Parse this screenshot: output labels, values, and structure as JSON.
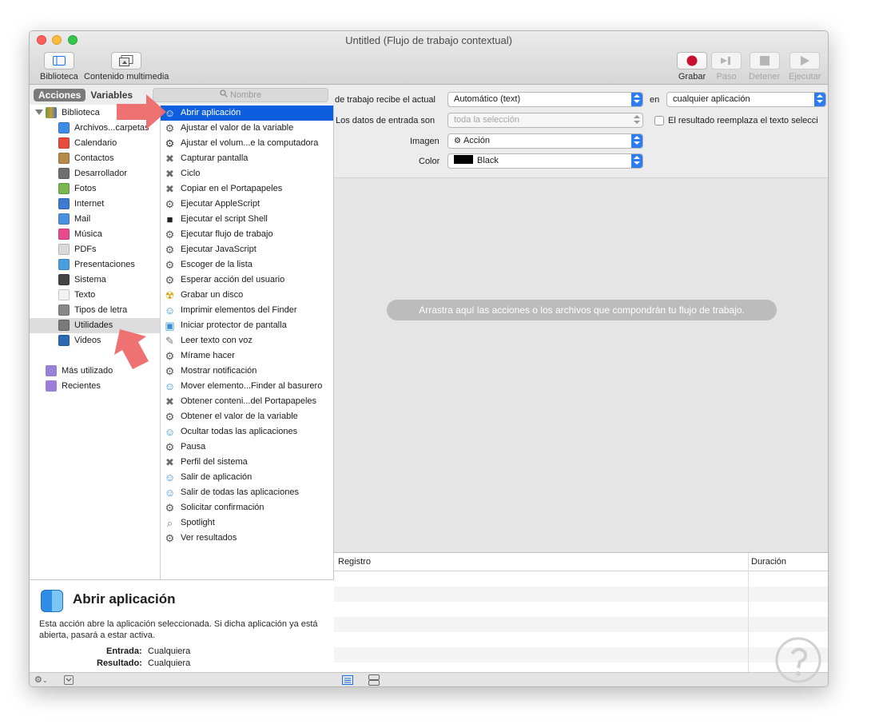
{
  "window": {
    "title": "Untitled (Flujo de trabajo contextual)"
  },
  "toolbar": {
    "left": [
      {
        "label": "Biblioteca",
        "icon": "sidebar-icon"
      },
      {
        "label": "Contenido multimedia",
        "icon": "media-icon"
      }
    ],
    "right": [
      {
        "label": "Grabar",
        "icon": "record-icon",
        "enabled": true
      },
      {
        "label": "Paso",
        "icon": "step-icon",
        "enabled": false
      },
      {
        "label": "Detener",
        "icon": "stop-icon",
        "enabled": false
      },
      {
        "label": "Ejecutar",
        "icon": "play-icon",
        "enabled": false
      }
    ]
  },
  "left_header": {
    "tab_actions": "Acciones",
    "tab_variables": "Variables",
    "search_placeholder": "Nombre"
  },
  "library": {
    "root": "Biblioteca",
    "items": [
      "Archivos...carpetas",
      "Calendario",
      "Contactos",
      "Desarrollador",
      "Fotos",
      "Internet",
      "Mail",
      "Música",
      "PDFs",
      "Presentaciones",
      "Sistema",
      "Texto",
      "Tipos de letra",
      "Utilidades",
      "Videos"
    ],
    "selected": "Utilidades",
    "extra": [
      "Más utilizado",
      "Recientes"
    ]
  },
  "actions": {
    "selected": "Abrir aplicación",
    "items": [
      "Abrir aplicación",
      "Ajustar el valor de la variable",
      "Ajustar el volum...e la computadora",
      "Capturar pantalla",
      "Ciclo",
      "Copiar en el Portapapeles",
      "Ejecutar AppleScript",
      "Ejecutar el script Shell",
      "Ejecutar flujo de trabajo",
      "Ejecutar JavaScript",
      "Escoger de la lista",
      "Esperar acción del usuario",
      "Grabar un disco",
      "Imprimir elementos del Finder",
      "Iniciar protector de pantalla",
      "Leer texto con voz",
      "Mírame hacer",
      "Mostrar notificación",
      "Mover elemento...Finder al basurero",
      "Obtener conteni...del Portapapeles",
      "Obtener el valor de la variable",
      "Ocultar todas las aplicaciones",
      "Pausa",
      "Perfil del sistema",
      "Salir de aplicación",
      "Salir de todas las aplicaciones",
      "Solicitar confirmación",
      "Spotlight",
      "Ver resultados"
    ]
  },
  "description": {
    "title": "Abrir aplicación",
    "text": "Esta acción abre la aplicación seleccionada. Si dicha aplicación ya está abierta, pasará a estar activa.",
    "input_label": "Entrada:",
    "input_value": "Cualquiera",
    "result_label": "Resultado:",
    "result_value": "Cualquiera"
  },
  "workflow_options": {
    "receives_label": "de trabajo recibe el actual",
    "receives_value": "Automático (text)",
    "in_label": "en",
    "in_value": "cualquier aplicación",
    "input_is_label": "Los datos de entrada son",
    "input_is_value": "toda la selección",
    "replace_label": "El resultado reemplaza el texto selecci",
    "image_label": "Imagen",
    "image_value": "Acción",
    "color_label": "Color",
    "color_value": "Black",
    "color_swatch": "#000000"
  },
  "canvas_hint": "Arrastra aquí las acciones o los archivos que compondrán tu flujo de trabajo.",
  "log": {
    "col1": "Registro",
    "col2": "Duración"
  },
  "colors": {
    "selection": "#0d5fe0",
    "accent": "#2f7cf2",
    "arrow": "#ee6a6a",
    "record": "#c8102e"
  }
}
